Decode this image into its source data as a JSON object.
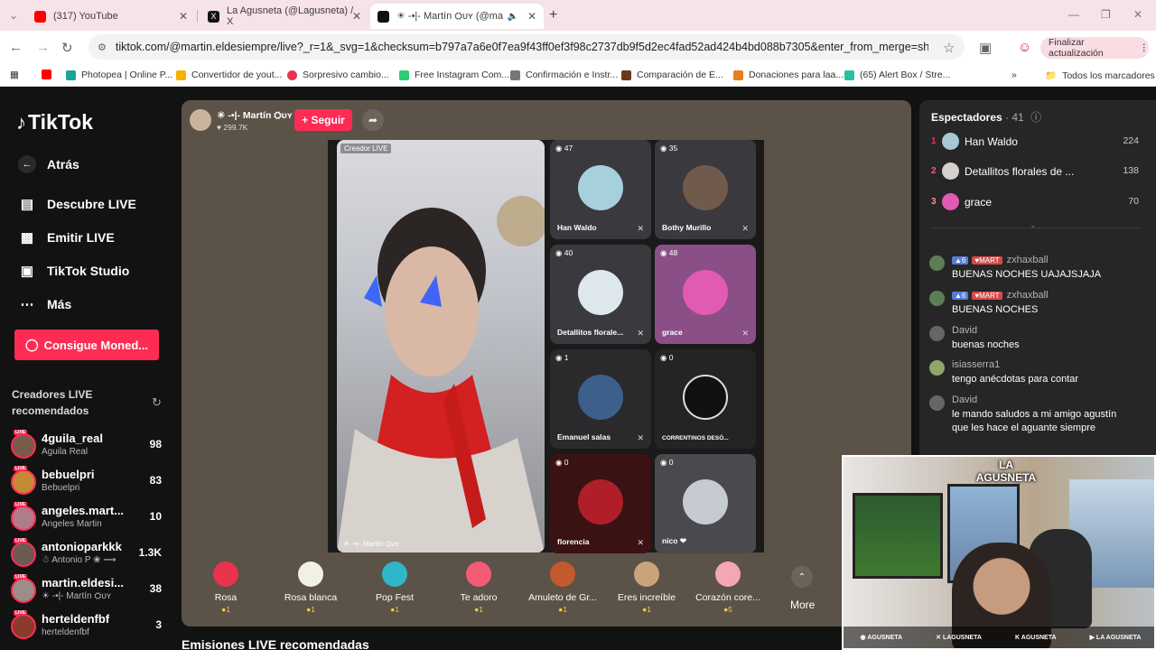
{
  "browser": {
    "tabs": [
      {
        "title": "(317) YouTube",
        "color": "#ff0000"
      },
      {
        "title": "La Agusneta (@Lagusneta) / X",
        "color": "#000000"
      },
      {
        "title": "☀ -•|- Martín ⛭ᴜʏ (@mar",
        "color": "#000000"
      }
    ],
    "url": "tiktok.com/@martin.eldesiempre/live?_r=1&_svg=1&checksum=b797a7a6e0f7ea9f43ff0ef3f98c2737db9f5d2ec4fad52ad424b4bd088b7305&enter_from_merge=share&enter_method...",
    "update_label": "Finalizar actualización",
    "bookmarks": [
      {
        "label": "Photopea | Online P...",
        "color": "#18a497"
      },
      {
        "label": "Convertidor de yout...",
        "color": "#f5b300"
      },
      {
        "label": "Sorpresivo cambio...",
        "color": "#e8344e"
      },
      {
        "label": "Free Instagram Com...",
        "color": "#2ecc71"
      },
      {
        "label": "Confirmación e Instr...",
        "color": "#777777"
      },
      {
        "label": "Comparación de E...",
        "color": "#6a3b1a"
      },
      {
        "label": "Donaciones para laa...",
        "color": "#e67e22"
      },
      {
        "label": "(65) Alert Box / Stre...",
        "color": "#2bbf9e"
      }
    ],
    "all_bookmarks": "Todos los marcadores"
  },
  "sidebar": {
    "brand": "TikTok",
    "nav": [
      {
        "label": "Atrás",
        "icon": "arrow-left-icon"
      },
      {
        "label": "Descubre LIVE",
        "icon": "tv-icon"
      },
      {
        "label": "Emitir LIVE",
        "icon": "camera-icon"
      },
      {
        "label": "TikTok Studio",
        "icon": "studio-icon"
      },
      {
        "label": "Más",
        "icon": "dots-icon"
      }
    ],
    "coins_button": "Consigue Moned...",
    "recommended_title": "Creadores LIVE recomendados",
    "creators": [
      {
        "name": "4guila_real",
        "sub": "Aguila Real",
        "count": "98",
        "color": "#7a5a4a"
      },
      {
        "name": "bebuelpri",
        "sub": "Bebuelpri",
        "count": "83",
        "color": "#c48a36"
      },
      {
        "name": "angeles.mart...",
        "sub": "Angeles Martin",
        "count": "10",
        "color": "#b07c8c"
      },
      {
        "name": "antonioparkkk",
        "sub": "☃ Antonio P ❀ ⟿",
        "count": "1.3K",
        "color": "#6b5b52"
      },
      {
        "name": "martin.eldesi...",
        "sub": "☀ -•|- Martín ⛭ᴜʏ",
        "count": "38",
        "color": "#9c8e86"
      },
      {
        "name": "herteldenfbf",
        "sub": "herteldenfbf",
        "count": "3",
        "color": "#8a3b2b"
      }
    ],
    "live_tag": "LIVE"
  },
  "stream": {
    "host_name": "☀ -•|- Martín ⛭ᴜʏ",
    "host_likes": "♥ 299.7K",
    "follow_label": "+ Seguir",
    "creator_badge": "Creador LIVE",
    "main_label": "☀ -•|- Martín ⛭ᴜʏ",
    "guests": [
      {
        "name": "Han Waldo",
        "viewers": "47",
        "color": "#a7d0dd"
      },
      {
        "name": "Bothy Murillo",
        "viewers": "35",
        "color": "#6f5a4c"
      },
      {
        "name": "Detallitos florale...",
        "viewers": "40",
        "color": "#dfe7ee"
      },
      {
        "name": "grace",
        "viewers": "48",
        "color": "#e05bb1"
      },
      {
        "name": "Emanuel salas",
        "viewers": "1",
        "color": "#3d5f8c"
      },
      {
        "name": "CORRENTINOS DESÓ...",
        "viewers": "0",
        "color": "#111111"
      },
      {
        "name": "florencia",
        "viewers": "0",
        "color": "#b01e2a"
      },
      {
        "name": "nico ❤",
        "viewers": "0",
        "color": "#c6cbd1"
      }
    ],
    "gifts": [
      {
        "name": "Rosa",
        "price": "●1",
        "color": "#e8334d"
      },
      {
        "name": "Rosa blanca",
        "price": "●1",
        "color": "#f1efe6"
      },
      {
        "name": "Pop Fest",
        "price": "●1",
        "color": "#2fb7c9"
      },
      {
        "name": "Te adoro",
        "price": "●1",
        "color": "#f25b76"
      },
      {
        "name": "Amuleto de Gr...",
        "price": "●1",
        "color": "#c25a2e"
      },
      {
        "name": "Eres increíble",
        "price": "●1",
        "color": "#c9a47a"
      },
      {
        "name": "Corazón core...",
        "price": "●5",
        "color": "#f3a7b4"
      }
    ],
    "more_label": "More",
    "recommended_live": "Emisiones LIVE recomendadas"
  },
  "panel": {
    "viewers_title": "Espectadores",
    "viewers_count": "· 41",
    "viewers": [
      {
        "rank": "1",
        "name": "Han Waldo",
        "score": "224",
        "color": "#a7c6d6"
      },
      {
        "rank": "2",
        "name": "Detallitos florales de ...",
        "score": "138",
        "color": "#d6d0cc"
      },
      {
        "rank": "3",
        "name": "grace",
        "score": "70",
        "color": "#e05bb1"
      }
    ],
    "chat": [
      {
        "user": "zxhaxball",
        "level": "6",
        "fan": "MART",
        "text": "BUENAS NOCHES UAJAJSJAJA",
        "color": "#5d7d57"
      },
      {
        "user": "zxhaxball",
        "level": "6",
        "fan": "MART",
        "text": "BUENAS NOCHES",
        "color": "#5d7d57"
      },
      {
        "user": "David",
        "level": "",
        "fan": "",
        "text": "buenas noches",
        "color": "#666666"
      },
      {
        "user": "isiasserra1",
        "level": "",
        "fan": "",
        "text": "tengo anécdotas para contar",
        "color": "#8fa66a"
      },
      {
        "user": "David",
        "level": "",
        "fan": "",
        "text": "le mando saludos a mi amigo agustín que les hace el aguante siempre",
        "color": "#666666"
      }
    ]
  },
  "webcam": {
    "logo": "LA AGUSNETA",
    "socials": [
      "AGUSNETA",
      "LAGUSNETA",
      "AGUSNETA",
      "LA AGUSNETA"
    ]
  }
}
